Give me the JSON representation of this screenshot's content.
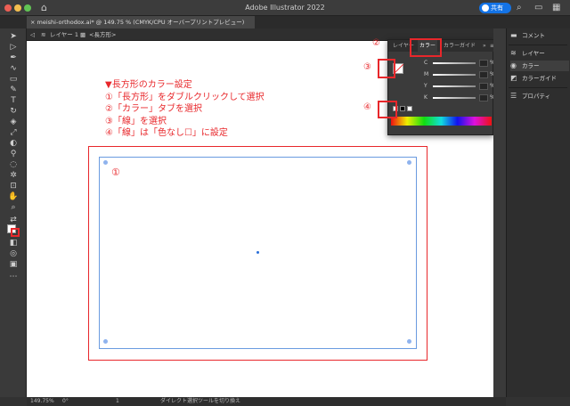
{
  "titlebar": {
    "home_icon": "home-icon",
    "title": "Adobe Illustrator 2022",
    "share_label": "共有",
    "search_icon": "search-icon"
  },
  "document_tab": {
    "close": "×",
    "label": "meishi-orthodox.ai* @ 149.75 % (CMYK/CPU オーバープリントプレビュー)"
  },
  "breadcrumb": {
    "back": "◁",
    "layer_label": "レイヤー 1",
    "object_label": "<長方形>"
  },
  "instructions": {
    "heading": "▼長方形のカラー設定",
    "step1": "①「長方形」をダブルクリックして選択",
    "step2": "②「カラー」タブを選択",
    "step3": "③「線」を選択",
    "step4": "④「線」は「色なし☐」に設定"
  },
  "canvas_marker": "①",
  "color_panel": {
    "tabs": [
      "レイヤー",
      "カラー",
      "カラーガイド"
    ],
    "menu": "≡",
    "collapse": "»",
    "rows": [
      {
        "label": "C",
        "unit": "%"
      },
      {
        "label": "M",
        "unit": "%"
      },
      {
        "label": "Y",
        "unit": "%"
      },
      {
        "label": "K",
        "unit": "%"
      }
    ]
  },
  "callouts": {
    "tab": "②",
    "stroke": "③",
    "none": "④"
  },
  "dock": {
    "items": [
      {
        "label": "コメント",
        "icon": "comment-icon"
      },
      {
        "label": "レイヤー",
        "icon": "layers-icon"
      },
      {
        "label": "カラー",
        "icon": "color-icon"
      },
      {
        "label": "カラーガイド",
        "icon": "color-guide-icon"
      },
      {
        "label": "プロパティ",
        "icon": "properties-icon"
      }
    ]
  },
  "statusbar": {
    "zoom": "149.75%",
    "rotation": "0°",
    "artboard": "1",
    "tool": "ダイレクト選択ツールを切り換え"
  },
  "colors": {
    "annotation_red": "#e8272b",
    "artboard_blue": "#6a9be0",
    "share_blue": "#1473e6"
  }
}
